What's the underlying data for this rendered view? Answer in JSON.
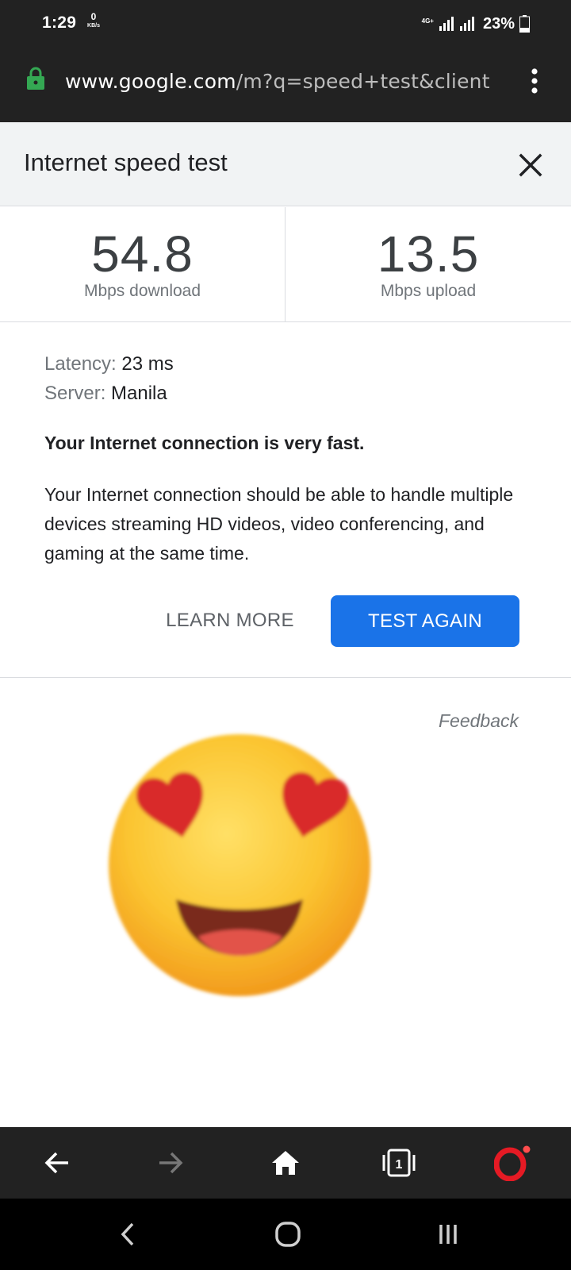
{
  "status_bar": {
    "time": "1:29",
    "net_speed_value": "0",
    "net_speed_unit": "KB/s",
    "network_type": "4G+",
    "battery_percent": "23%"
  },
  "url_bar": {
    "host": "www.google.com",
    "path": "/m?q=speed+test&client",
    "icons": [
      "lock-icon",
      "more-vert-icon"
    ]
  },
  "speed_test": {
    "title": "Internet speed test",
    "download_value": "54.8",
    "download_label": "Mbps download",
    "upload_value": "13.5",
    "upload_label": "Mbps upload",
    "latency_label": "Latency:",
    "latency_value": "23 ms",
    "server_label": "Server:",
    "server_value": "Manila",
    "verdict": "Your Internet connection is very fast.",
    "description": "Your Internet connection should be able to handle multiple devices streaming HD videos, video conferencing, and gaming at the same time.",
    "learn_more_label": "LEARN MORE",
    "test_again_label": "TEST AGAIN",
    "feedback_label": "Feedback"
  },
  "browser_bar": {
    "tab_count": "1",
    "icons": [
      "back-arrow-icon",
      "forward-arrow-icon",
      "home-icon",
      "tabs-icon",
      "opera-logo-icon"
    ]
  },
  "system_nav": {
    "icons": [
      "nav-back-icon",
      "nav-home-icon",
      "nav-recents-icon"
    ]
  },
  "colors": {
    "accent": "#1a73e8",
    "bar_background": "#222222",
    "lock_green": "#34a853",
    "opera_red": "#e51a24"
  }
}
